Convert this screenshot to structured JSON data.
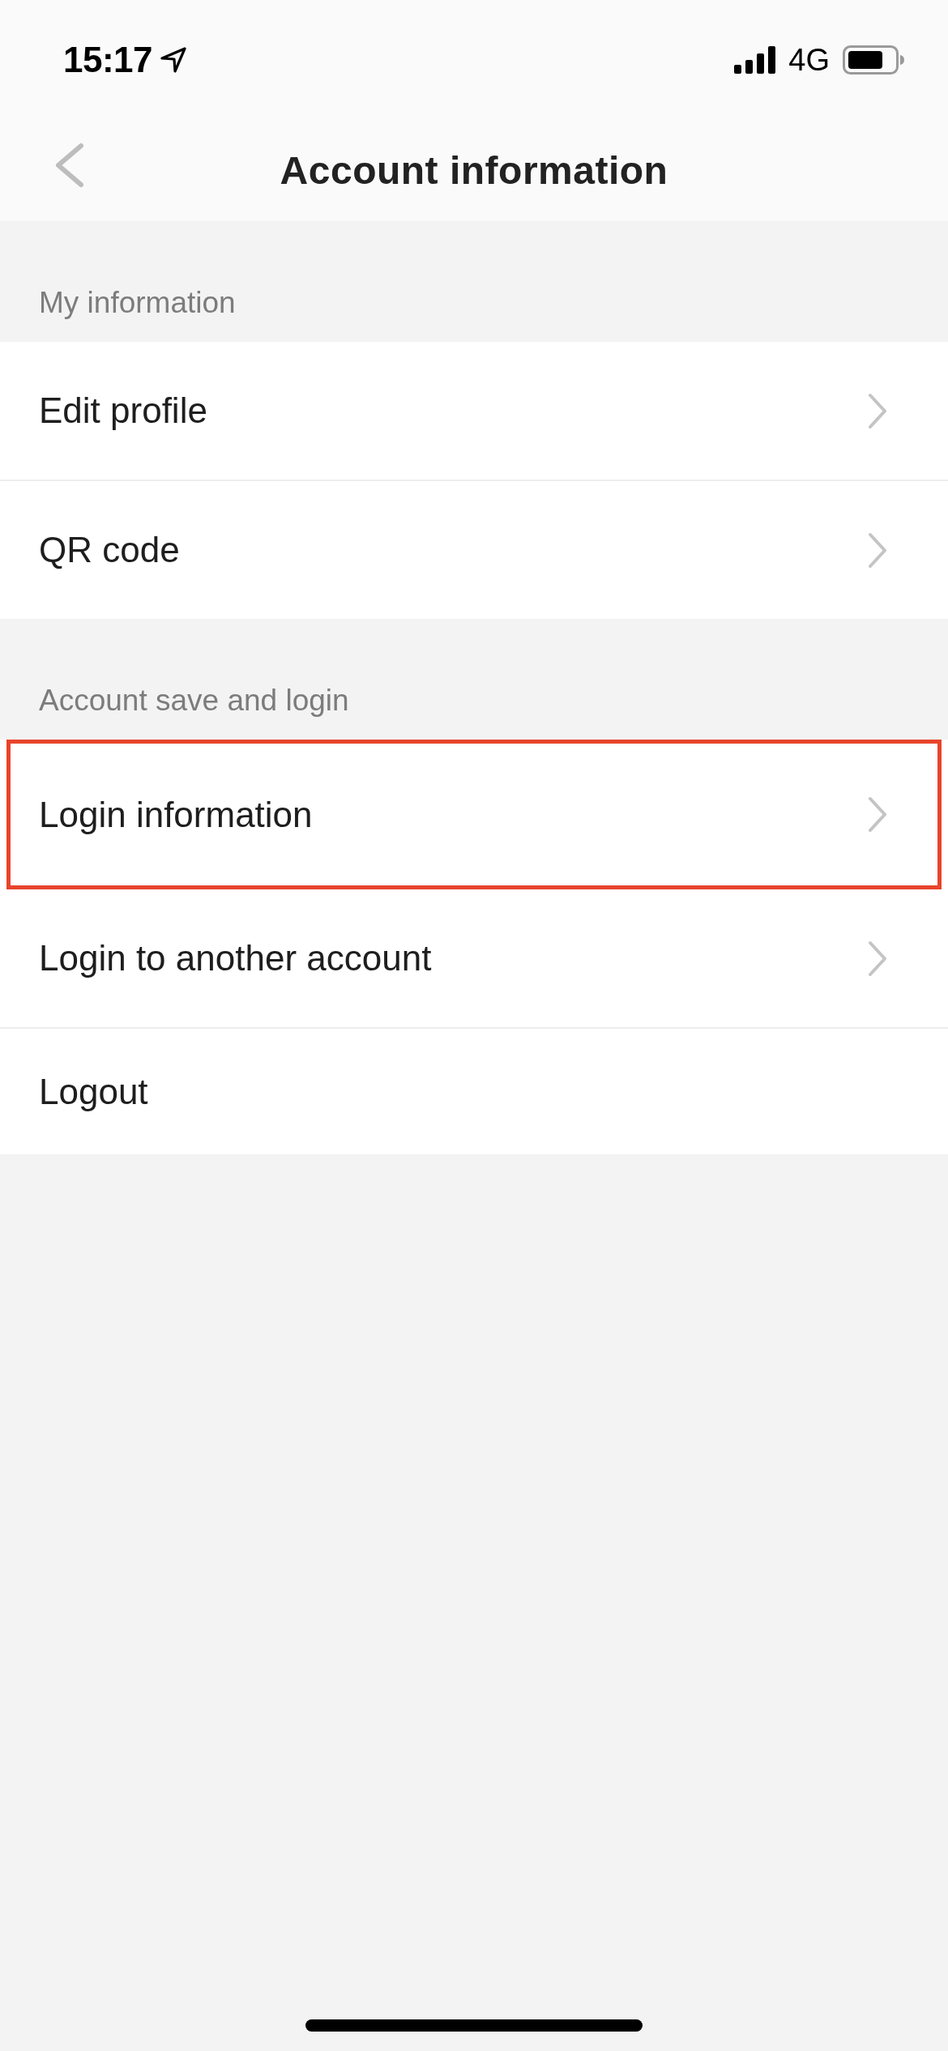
{
  "status_bar": {
    "time": "15:17",
    "network": "4G"
  },
  "nav_bar": {
    "title": "Account information"
  },
  "sections": [
    {
      "header": "My information",
      "items": [
        {
          "label": "Edit profile",
          "chevron": true,
          "highlighted": false
        },
        {
          "label": "QR code",
          "chevron": true,
          "highlighted": false
        }
      ]
    },
    {
      "header": "Account save and login",
      "items": [
        {
          "label": "Login information",
          "chevron": true,
          "highlighted": true
        },
        {
          "label": "Login to another account",
          "chevron": true,
          "highlighted": false
        },
        {
          "label": "Logout",
          "chevron": false,
          "highlighted": false
        }
      ]
    }
  ]
}
